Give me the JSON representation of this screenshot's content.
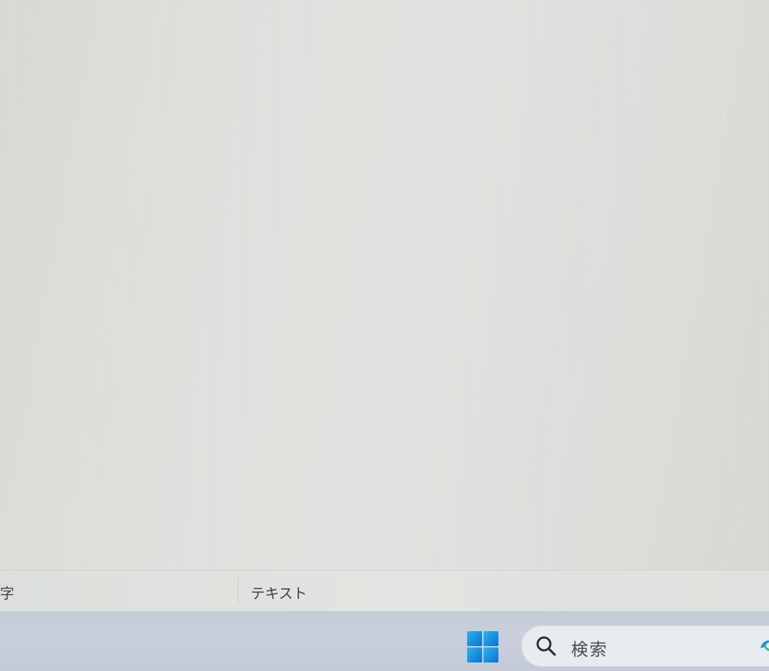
{
  "status_bar": {
    "left_text": "字",
    "right_text": "テキスト"
  },
  "taskbar": {
    "start_icon": "windows-logo-icon",
    "search": {
      "placeholder": "検索",
      "icon": "search-icon"
    },
    "pinned_icon": "app-icon"
  },
  "colors": {
    "windows_blue": "#1a8fe3",
    "taskbar": "#c7cfdb",
    "search_bg": "#e8ebef"
  }
}
